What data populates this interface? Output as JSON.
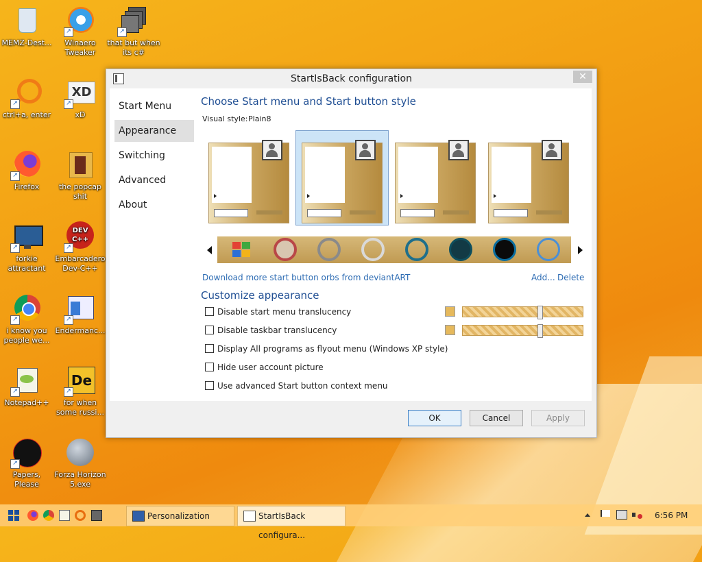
{
  "desktop": {
    "icons": [
      {
        "label": "MEMZ-Dest..."
      },
      {
        "label": "Winaero\nTweaker"
      },
      {
        "label": "that but when\nits c#"
      },
      {
        "label": "ctrl+a, enter"
      },
      {
        "label": "xD"
      },
      {
        "label": "Firefox"
      },
      {
        "label": "the popcap\nshit"
      },
      {
        "label": "forkie\nattractant"
      },
      {
        "label": "Embarcadero\nDev-C++"
      },
      {
        "label": "i know you\npeople we..."
      },
      {
        "label": "Endermanc..."
      },
      {
        "label": "Notepad++"
      },
      {
        "label": "for when\nsome russi..."
      },
      {
        "label": "Papers, Please"
      },
      {
        "label": "Forza Horizon\n5.exe"
      }
    ],
    "icon_texts": {
      "devcpp": "DEV\nC++",
      "xd": "XD",
      "de": "De"
    }
  },
  "dialog": {
    "title": "StartIsBack configuration",
    "close": "✕",
    "nav": [
      "Start Menu",
      "Appearance",
      "Switching",
      "Advanced",
      "About"
    ],
    "selected_nav": "Appearance",
    "heading": "Choose Start menu and Start button style",
    "visual_style_label": "Visual style:",
    "visual_style_value": "Plain8",
    "download_link": "Download more start button orbs from deviantART",
    "add_link": "Add...",
    "delete_link": "Delete",
    "customize_heading": "Customize appearance",
    "options": [
      {
        "label": "Disable start menu translucency",
        "checked": false
      },
      {
        "label": "Disable taskbar translucency",
        "checked": false
      },
      {
        "label": "Display All programs as flyout menu (Windows XP style)",
        "checked": false
      },
      {
        "label": "Hide user account picture",
        "checked": false
      },
      {
        "label": "Use advanced Start button context menu",
        "checked": false
      }
    ],
    "buttons": {
      "ok": "OK",
      "cancel": "Cancel",
      "apply": "Apply"
    },
    "slider_levels": [
      0.65,
      0.65
    ]
  },
  "taskbar": {
    "items": [
      {
        "label": "Personalization"
      },
      {
        "label": "StartIsBack configura..."
      }
    ],
    "clock": "6:56 PM"
  },
  "colors": {
    "accent": "#1f4e93",
    "link": "#2c6bb3",
    "tint": "#e6b95c"
  }
}
